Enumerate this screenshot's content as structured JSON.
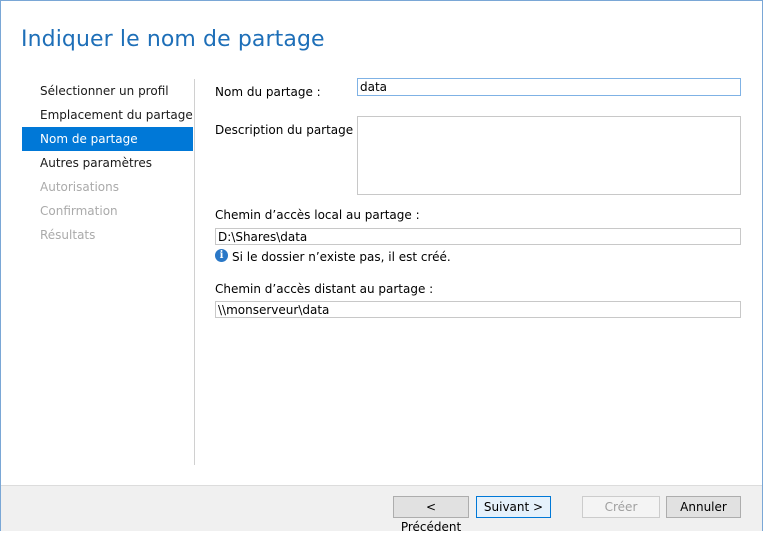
{
  "page": {
    "title": "Indiquer le nom de partage"
  },
  "nav": {
    "items": [
      {
        "label": "Sélectionner un profil",
        "state": "normal"
      },
      {
        "label": "Emplacement du partage",
        "state": "normal"
      },
      {
        "label": "Nom de partage",
        "state": "selected"
      },
      {
        "label": "Autres paramètres",
        "state": "normal"
      },
      {
        "label": "Autorisations",
        "state": "disabled"
      },
      {
        "label": "Confirmation",
        "state": "disabled"
      },
      {
        "label": "Résultats",
        "state": "disabled"
      }
    ]
  },
  "form": {
    "share_name_label": "Nom du partage :",
    "share_name_value": "data",
    "description_label": "Description du partage :",
    "description_value": "",
    "local_path_label": "Chemin d’accès local au partage :",
    "local_path_value": "D:\\Shares\\data",
    "info_text": "Si le dossier n’existe pas, il est créé.",
    "remote_path_label": "Chemin d’accès distant au partage :",
    "remote_path_value": "\\\\monserveur\\data"
  },
  "footer": {
    "previous_label": "< Précédent",
    "next_label": "Suivant >",
    "create_label": "Créer",
    "cancel_label": "Annuler"
  },
  "colors": {
    "accent": "#0078d7",
    "title": "#1e6fb8",
    "disabled_text": "#aaaaaa"
  },
  "icons": {
    "info": "info-icon"
  }
}
